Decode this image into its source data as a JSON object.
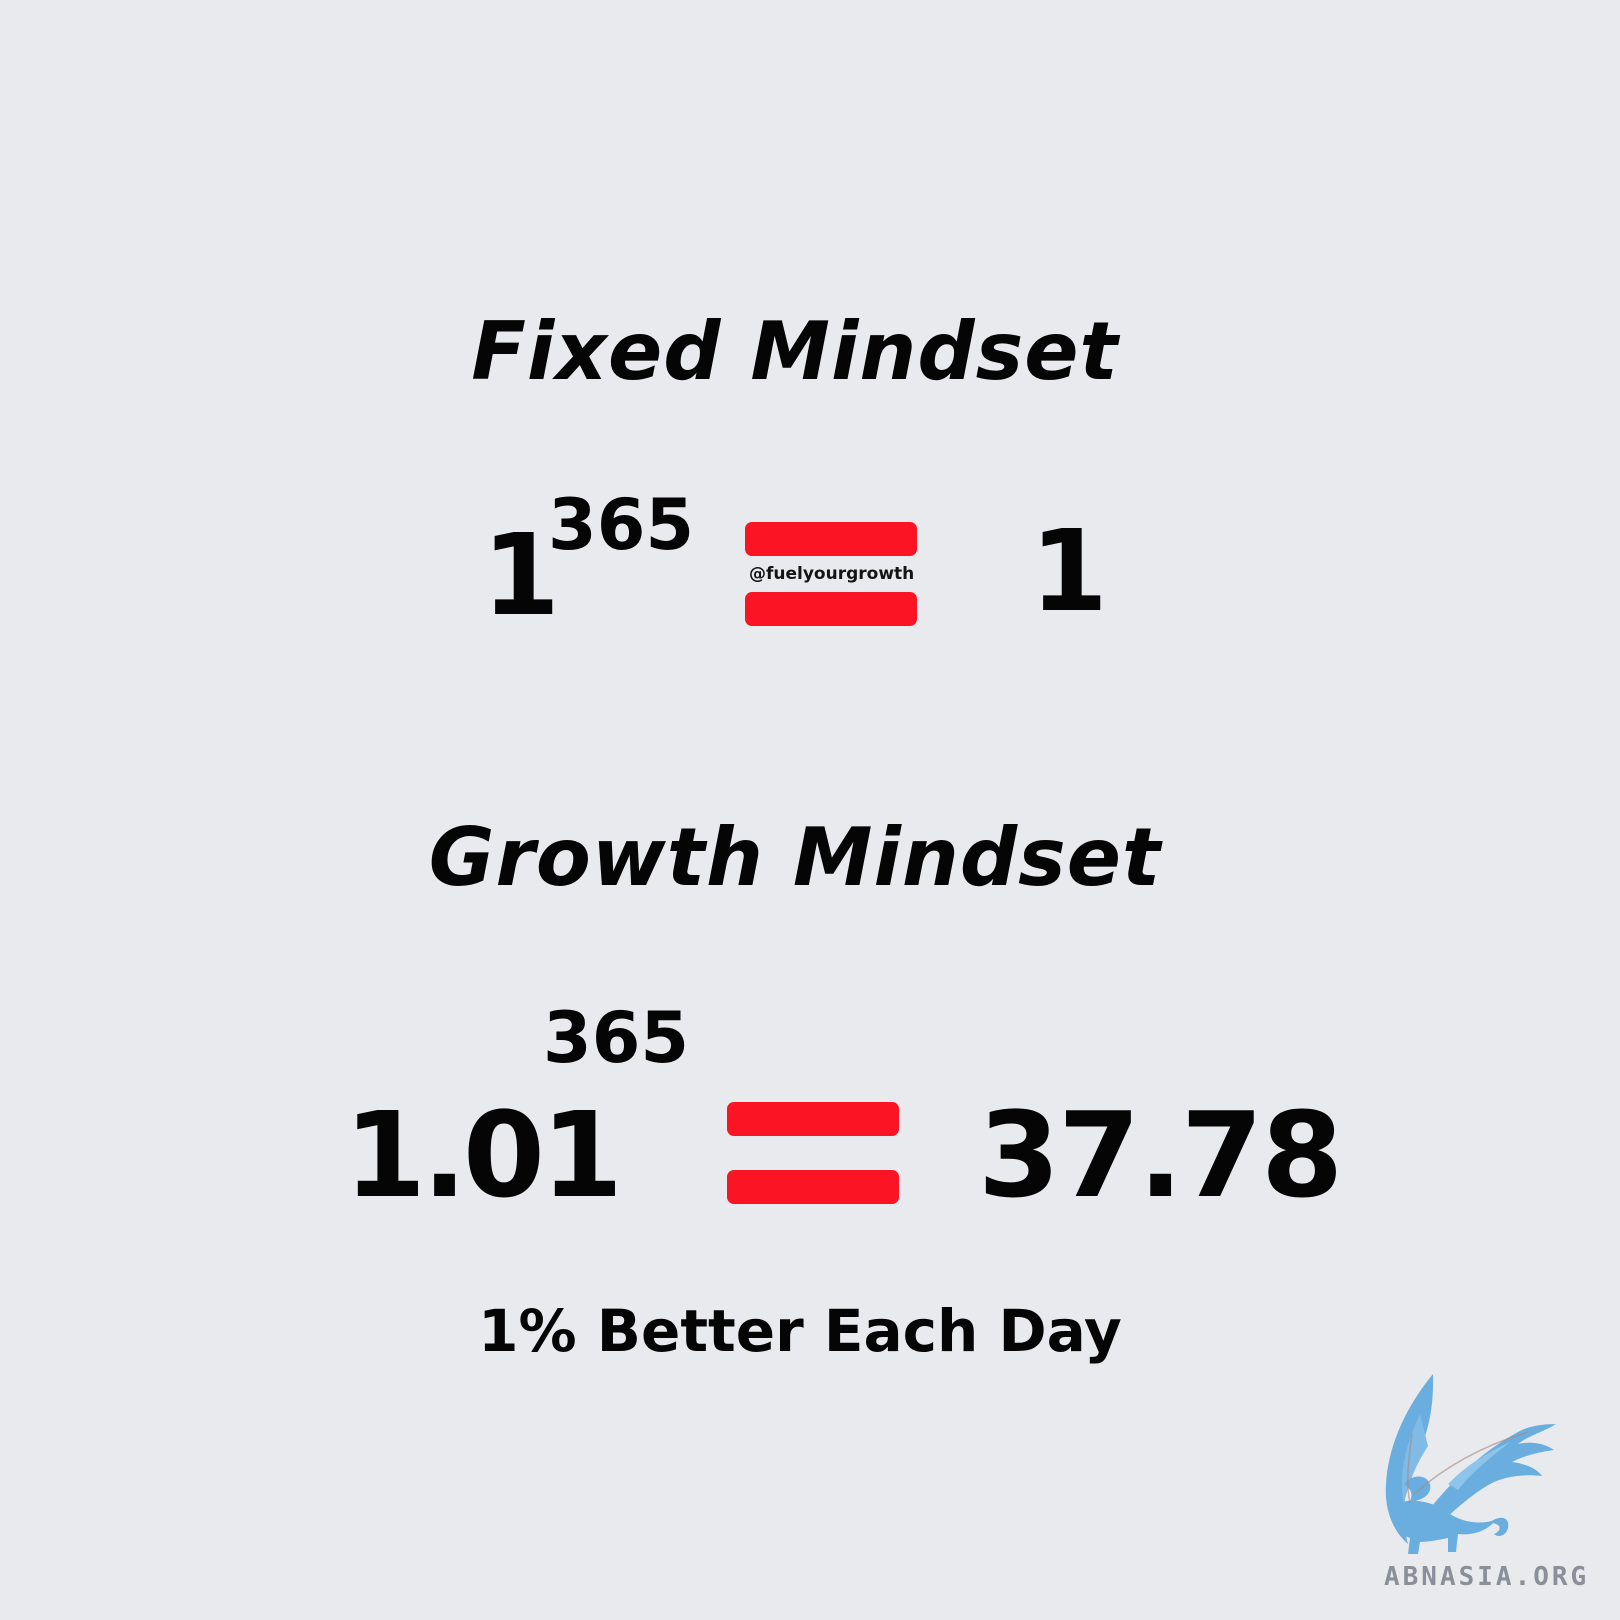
{
  "fixed": {
    "title": "Fixed Mindset",
    "base": "1",
    "exponent": "365",
    "result": "1"
  },
  "growth": {
    "title": "Growth Mindset",
    "base": "1.01",
    "exponent": "365",
    "result": "37.78"
  },
  "watermark": "@fuelyourgrowth",
  "tagline": "1% Better Each Day",
  "logo": {
    "text": "ABNASIA.ORG",
    "icon": "griffin-icon",
    "color": "#6aaee0"
  },
  "colors": {
    "background": "#e9eaee",
    "equals_sign": "#fb1424",
    "text": "#050505"
  }
}
